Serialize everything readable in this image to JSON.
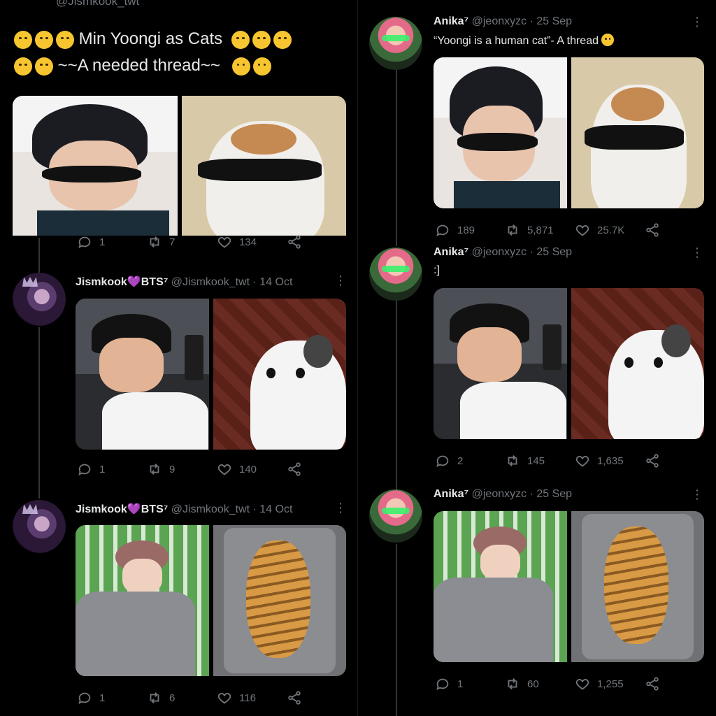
{
  "left": {
    "top_handle": "@Jismkook_twt",
    "thread_title_text": "Min Yoongi as Cats",
    "thread_subtitle": "~~A needed thread~~",
    "first_actions": {
      "reply": "1",
      "retweet": "7",
      "like": "134"
    },
    "tweets": [
      {
        "name": "Jismkook",
        "heart": "💜",
        "name_suffix": "BTS⁷",
        "handle_date": "@Jismkook_twt · 14 Oct",
        "actions": {
          "reply": "1",
          "retweet": "9",
          "like": "140"
        }
      },
      {
        "name": "Jismkook",
        "heart": "💜",
        "name_suffix": "BTS⁷",
        "handle_date": "@Jismkook_twt · 14 Oct",
        "actions": {
          "reply": "1",
          "retweet": "6",
          "like": "116"
        }
      }
    ]
  },
  "right": {
    "tweets": [
      {
        "name": "Anika⁷",
        "handle_date": "@jeonxyzc · 25 Sep",
        "text": "“Yoongi is a human cat”- A thread",
        "actions": {
          "reply": "189",
          "retweet": "5,871",
          "like": "25.7K"
        }
      },
      {
        "name": "Anika⁷",
        "handle_date": "@jeonxyzc · 25 Sep",
        "text": ":]",
        "actions": {
          "reply": "2",
          "retweet": "145",
          "like": "1,635"
        }
      },
      {
        "name": "Anika⁷",
        "handle_date": "@jeonxyzc · 25 Sep",
        "text": "",
        "actions": {
          "reply": "1",
          "retweet": "60",
          "like": "1,255"
        }
      }
    ]
  },
  "icons": [
    "reply-icon",
    "retweet-icon",
    "like-icon",
    "share-icon",
    "more-icon"
  ],
  "colors": {
    "background": "#000000",
    "text": "#e7e9ea",
    "muted": "#71767b",
    "heart": "#a855f7"
  }
}
